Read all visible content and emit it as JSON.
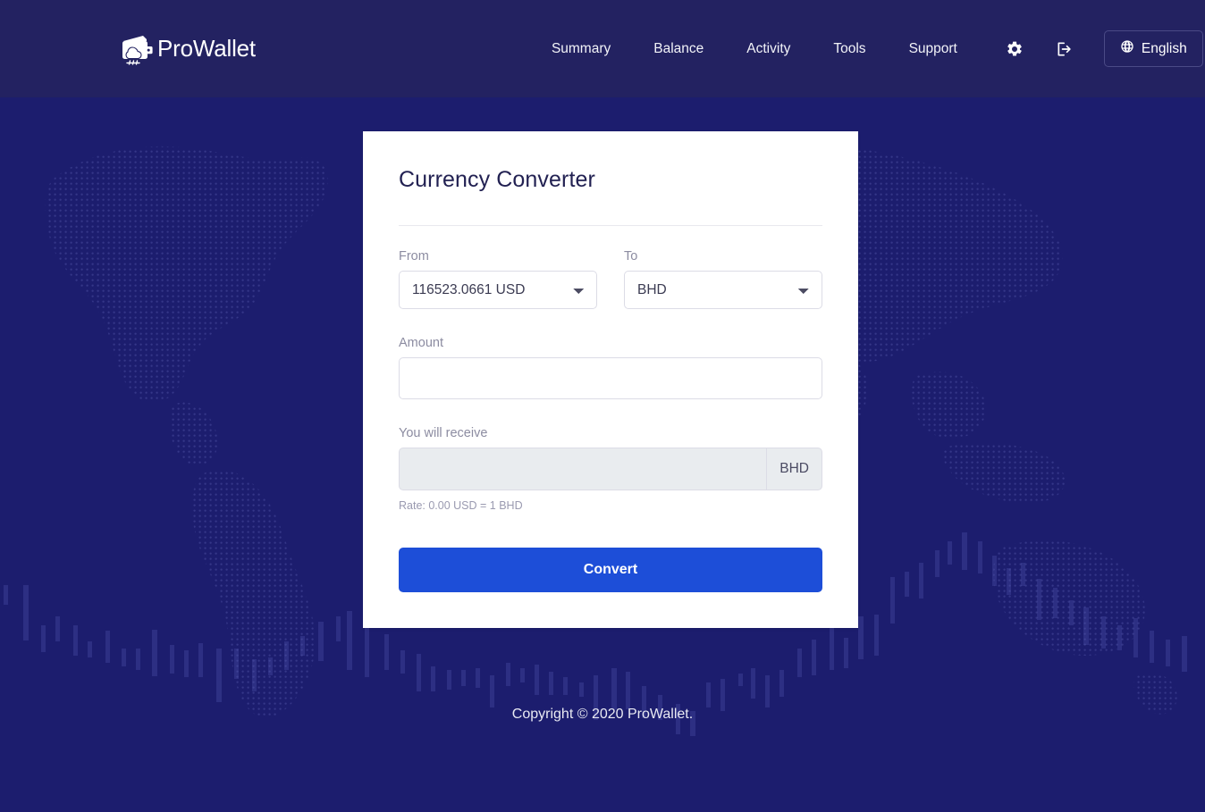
{
  "colors": {
    "header_bg": "#232261",
    "page_bg": "#1c1d6e",
    "card_bg": "#ffffff",
    "accent_button": "#1d4ed8",
    "title_text": "#222152",
    "muted_label": "#8c8ca1",
    "input_border": "#dcdce6",
    "readonly_bg": "#e9ecef"
  },
  "header": {
    "brand": {
      "text": "ProWallet",
      "icon": "wallet-cloud-icon"
    },
    "nav_items": [
      {
        "label": "Summary",
        "name": "summary"
      },
      {
        "label": "Balance",
        "name": "balance"
      },
      {
        "label": "Activity",
        "name": "activity"
      },
      {
        "label": "Tools",
        "name": "tools"
      },
      {
        "label": "Support",
        "name": "support"
      }
    ],
    "settings_icon": "gear-icon",
    "logout_icon": "sign-out-icon",
    "language_button": {
      "label": "English",
      "icon": "globe-icon"
    }
  },
  "converter": {
    "title": "Currency Converter",
    "from": {
      "label": "From",
      "selected": "116523.0661 USD",
      "options": [
        "116523.0661 USD"
      ]
    },
    "to": {
      "label": "To",
      "selected": "BHD",
      "options": [
        "BHD"
      ]
    },
    "amount": {
      "label": "Amount",
      "value": "",
      "placeholder": ""
    },
    "receive": {
      "label": "You will receive",
      "value": "",
      "placeholder": "",
      "currency_addon": "BHD"
    },
    "rate_note": "Rate: 0.00 USD = 1 BHD",
    "convert_button": "Convert"
  },
  "footer": {
    "copyright": "Copyright © 2020 ProWallet."
  }
}
